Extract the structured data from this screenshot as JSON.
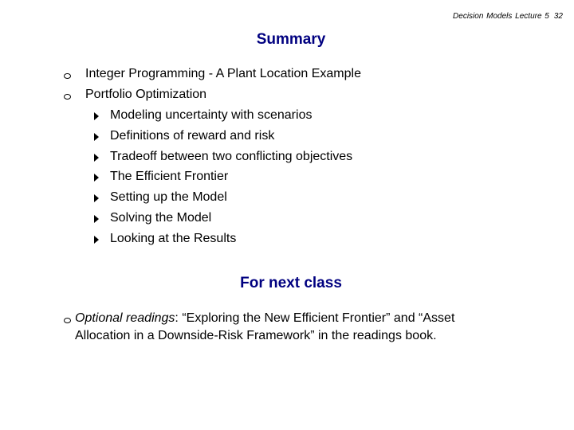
{
  "header": {
    "course": "Decision Models  Lecture 5",
    "page_number": "32"
  },
  "summary": {
    "title": "Summary",
    "items": [
      {
        "label": "Integer Programming - A Plant Location Example",
        "bullet_icon": "hollow-circle"
      },
      {
        "label": "Portfolio Optimization",
        "bullet_icon": "hollow-circle",
        "subitems": [
          {
            "label": "Modeling uncertainty with scenarios",
            "bullet_icon": "right-triangle"
          },
          {
            "label": "Definitions of reward and risk",
            "bullet_icon": "right-triangle"
          },
          {
            "label": "Tradeoff between two conflicting objectives",
            "bullet_icon": "right-triangle"
          },
          {
            "label": "The Efficient Frontier",
            "bullet_icon": "right-triangle"
          },
          {
            "label": "Setting up the Model",
            "bullet_icon": "right-triangle"
          },
          {
            "label": "Solving the Model",
            "bullet_icon": "right-triangle"
          },
          {
            "label": "Looking at the Results",
            "bullet_icon": "right-triangle"
          }
        ]
      }
    ]
  },
  "next_class": {
    "title": "For next class",
    "reading": {
      "label_italic": "Optional readings",
      "line1_rest": ": “Exploring the New Efficient Frontier” and “Asset",
      "line2": "Allocation in a Downside-Risk Framework” in the readings book.",
      "bullet_icon": "hollow-circle"
    }
  },
  "colors": {
    "title": "#000080",
    "text": "#000000",
    "background": "#ffffff"
  }
}
